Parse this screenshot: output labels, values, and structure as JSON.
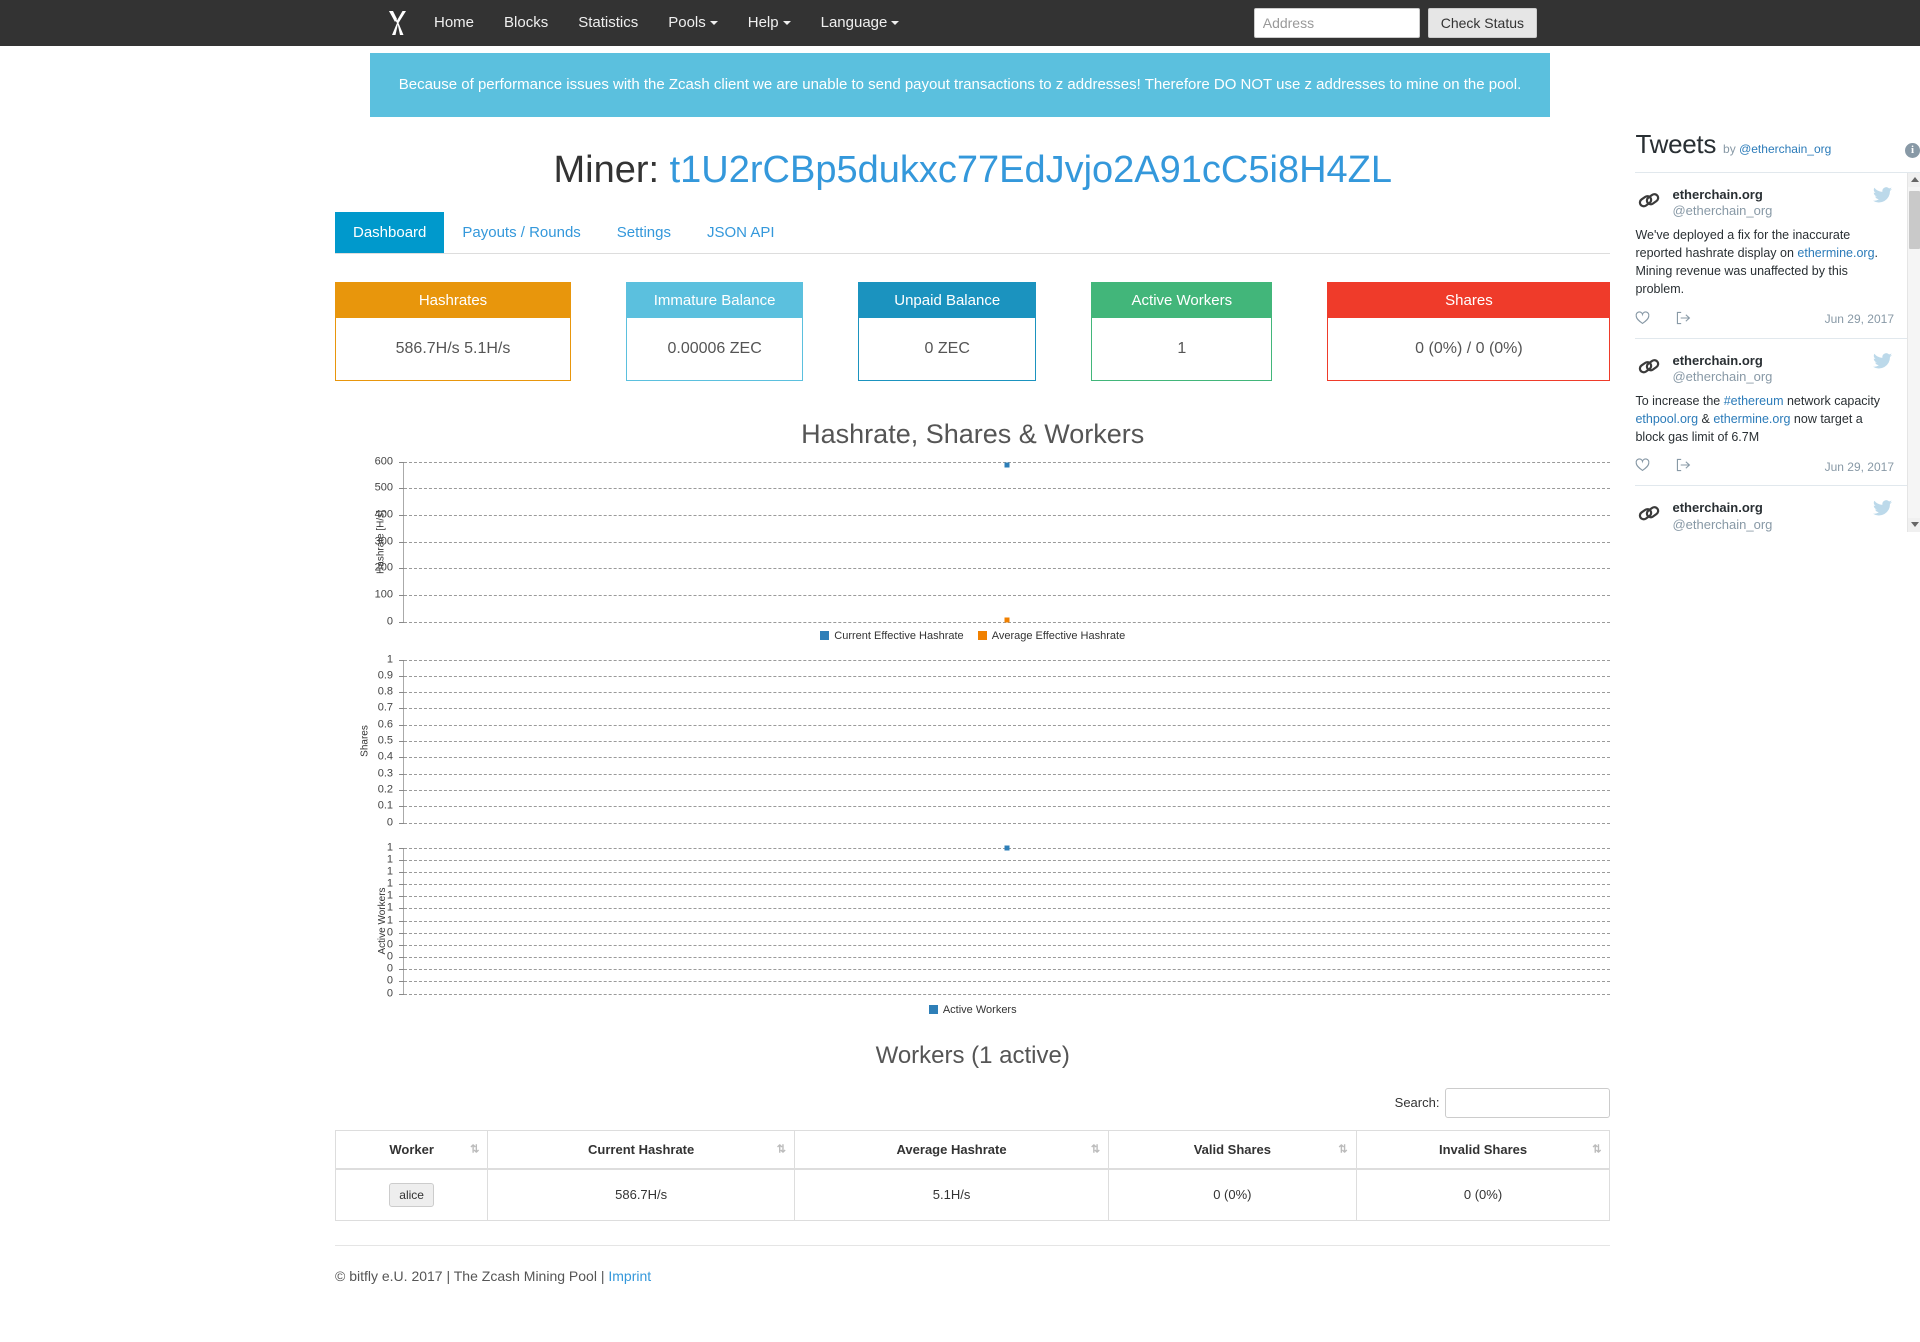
{
  "navbar": {
    "brand_icon": "crossed-pickaxes-logo",
    "links": [
      {
        "label": "Home",
        "caret": false
      },
      {
        "label": "Blocks",
        "caret": false
      },
      {
        "label": "Statistics",
        "caret": false
      },
      {
        "label": "Pools",
        "caret": true
      },
      {
        "label": "Help",
        "caret": true
      },
      {
        "label": "Language",
        "caret": true
      }
    ],
    "address_placeholder": "Address",
    "address_value": "",
    "check_status_label": "Check Status"
  },
  "alert": {
    "text": "Because of performance issues with the Zcash client we are unable to send payout transactions to z addresses! Therefore DO NOT use z addresses to mine on the pool.",
    "color": "#5bc0de"
  },
  "header": {
    "title_prefix": "Miner:",
    "miner_address": "t1U2rCBp5dukxc77EdJvjo2A91cC5i8H4ZL"
  },
  "tabs": [
    {
      "label": "Dashboard",
      "active": true
    },
    {
      "label": "Payouts / Rounds",
      "active": false
    },
    {
      "label": "Settings",
      "active": false
    },
    {
      "label": "JSON API",
      "active": false
    }
  ],
  "panels": [
    {
      "title": "Hashrates",
      "value": "586.7H/s  5.1H/s",
      "color": "#e8960c"
    },
    {
      "title": "Immature Balance",
      "value": "0.00006 ZEC",
      "color": "#5bc0de"
    },
    {
      "title": "Unpaid Balance",
      "value": "0 ZEC",
      "color": "#1b93bf"
    },
    {
      "title": "Active Workers",
      "value": "1",
      "color": "#42b67a"
    },
    {
      "title": "Shares",
      "value": "0 (0%) / 0 (0%)",
      "color": "#ef3b2a"
    }
  ],
  "chart_data": [
    {
      "type": "scatter",
      "title": "Hashrate, Shares & Workers",
      "ylabel": "Hashrate [H/s]",
      "xlabel": "",
      "ylim": [
        0,
        600
      ],
      "yticks": [
        0,
        100,
        200,
        300,
        400,
        500,
        600
      ],
      "grid": true,
      "legend_position": "bottom",
      "series": [
        {
          "name": "Current Effective Hashrate",
          "color": "#2e7fb8",
          "x": [
            0.5
          ],
          "values": [
            586.7
          ]
        },
        {
          "name": "Average Effective Hashrate",
          "color": "#f08000",
          "x": [
            0.5
          ],
          "values": [
            5.1
          ]
        }
      ]
    },
    {
      "type": "scatter",
      "title": "",
      "ylabel": "Shares",
      "xlabel": "",
      "ylim": [
        0,
        1
      ],
      "yticks": [
        0,
        0.1,
        0.2,
        0.3,
        0.4,
        0.5,
        0.6,
        0.7,
        0.8,
        0.9,
        1
      ],
      "grid": true,
      "legend_position": "none",
      "series": []
    },
    {
      "type": "scatter",
      "title": "",
      "ylabel": "Active Workers",
      "xlabel": "",
      "ylim": [
        0,
        1
      ],
      "yticks": [
        1,
        1,
        1,
        1,
        1,
        1,
        1,
        0,
        0,
        0,
        0,
        0,
        0
      ],
      "grid": true,
      "legend_position": "bottom",
      "series": [
        {
          "name": "Active Workers",
          "color": "#2e7fb8",
          "x": [
            0.5
          ],
          "values": [
            1
          ]
        }
      ]
    }
  ],
  "workers": {
    "title": "Workers (1 active)",
    "search_label": "Search:",
    "search_value": "",
    "columns": [
      "Worker",
      "Current Hashrate",
      "Average Hashrate",
      "Valid Shares",
      "Invalid Shares"
    ],
    "rows": [
      {
        "worker": "alice",
        "current_hashrate": "586.7H/s",
        "average_hashrate": "5.1H/s",
        "valid_shares": "0 (0%)",
        "invalid_shares": "0 (0%)"
      }
    ]
  },
  "footer": {
    "text": "© bitfly e.U. 2017 | The Zcash Mining Pool | ",
    "link": "Imprint"
  },
  "twitter": {
    "title": "Tweets",
    "by_prefix": "by",
    "handle": "@etherchain_org",
    "tweets": [
      {
        "name": "etherchain.org",
        "handle": "@etherchain_org",
        "text_parts": [
          {
            "t": "We've deployed a fix for the inaccurate reported hashrate display on ",
            "link": false
          },
          {
            "t": "ethermine.org",
            "link": true
          },
          {
            "t": ". Mining revenue was unaffected by this problem.",
            "link": false
          }
        ],
        "date": "Jun 29, 2017"
      },
      {
        "name": "etherchain.org",
        "handle": "@etherchain_org",
        "text_parts": [
          {
            "t": "To increase the ",
            "link": false
          },
          {
            "t": "#ethereum",
            "link": true
          },
          {
            "t": "  network capacity ",
            "link": false
          },
          {
            "t": "ethpool.org",
            "link": true
          },
          {
            "t": " & ",
            "link": false
          },
          {
            "t": "ethermine.org",
            "link": true
          },
          {
            "t": " now target a block gas limit of 6.7M",
            "link": false
          }
        ],
        "date": "Jun 29, 2017"
      },
      {
        "name": "etherchain.org",
        "handle": "@etherchain_org",
        "text_parts": [],
        "date": ""
      }
    ]
  }
}
